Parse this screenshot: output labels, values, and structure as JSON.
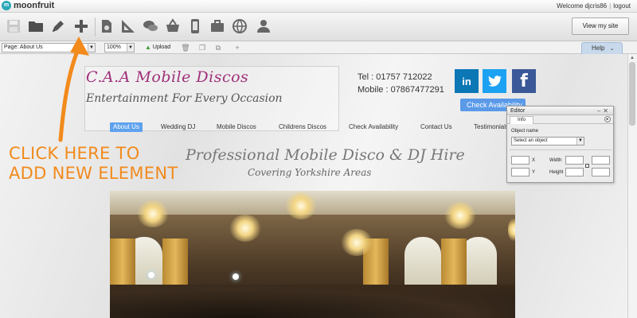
{
  "brand": {
    "logo_glyph": "m",
    "name": "moonfruit"
  },
  "account": {
    "welcome": "Welcome djcris86",
    "logout": "logout"
  },
  "toolbar": {
    "icons": [
      "save-icon",
      "folder-icon",
      "pen-icon",
      "add-element-icon",
      "new-page-icon",
      "ruler-icon",
      "chat-icon",
      "basket-icon",
      "mobile-icon",
      "briefcase-icon",
      "globe-icon",
      "user-icon"
    ],
    "view_site": "View my site"
  },
  "toolbar2": {
    "page_select": "Page: About Us",
    "zoom": "100%",
    "upload": "Upload",
    "help": "Help"
  },
  "site": {
    "title": "C.A.A Mobile Discos",
    "tagline": "Entertainment For Every Occasion",
    "tel": "Tel : 01757 712022",
    "mobile": "Mobile : 07867477291",
    "social": {
      "linkedin": "in",
      "facebook": "f"
    },
    "check_button": "Check Availability",
    "nav": [
      "About Us",
      "Wedding DJ",
      "Mobile Discos",
      "Childrens Discos",
      "Check Availability",
      "Contact Us",
      "Testimonials"
    ],
    "headline": "Professional Mobile Disco & DJ Hire",
    "subhead": "Covering Yorkshire Areas"
  },
  "editor": {
    "title": "Editor",
    "controls": "–✕",
    "tab": "Info",
    "object_name_label": "Object name",
    "object_select": "Select an object",
    "x_label": "X",
    "y_label": "Y",
    "width_label": "Width",
    "height_label": "Height"
  },
  "annotation": {
    "line1": "CLICK HERE TO",
    "line2": "ADD NEW ELEMENT",
    "color": "#f28a1c"
  }
}
